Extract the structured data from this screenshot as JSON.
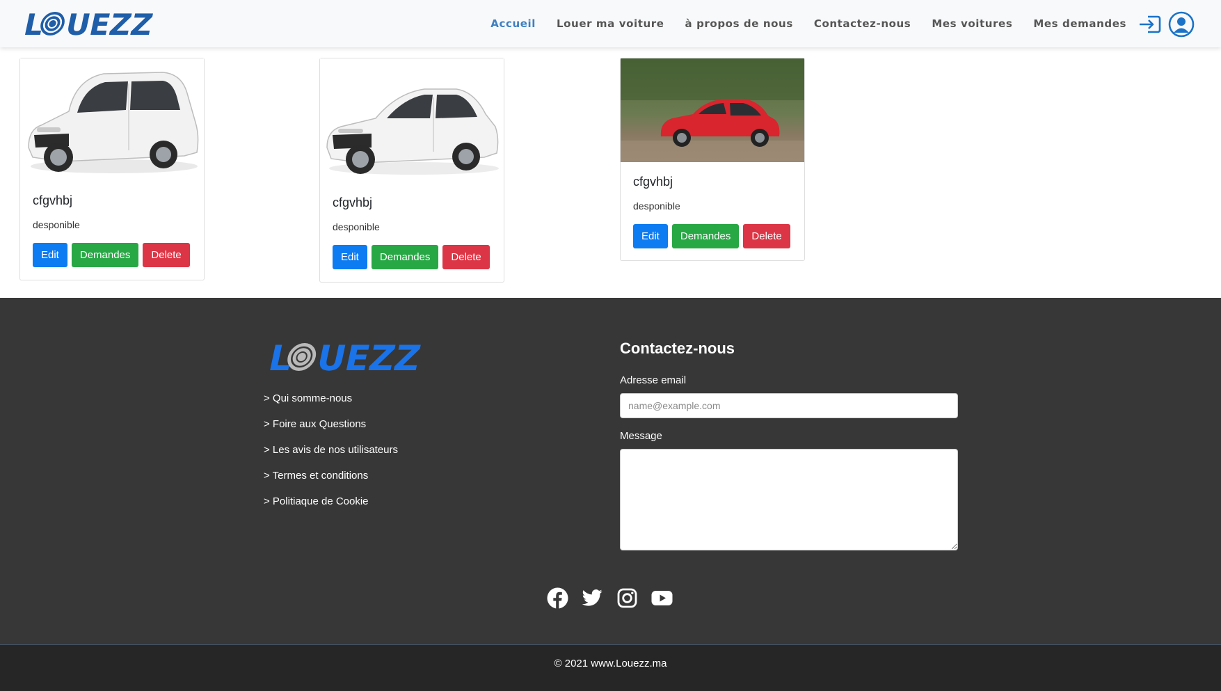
{
  "brand": {
    "logo_text": "LOUEZZ",
    "color": "#1f5ea8"
  },
  "nav": {
    "items": [
      {
        "label": "Accueil",
        "active": true
      },
      {
        "label": "Louer ma voiture",
        "active": false
      },
      {
        "label": "à propos de nous",
        "active": false
      },
      {
        "label": "Contactez-nous",
        "active": false
      },
      {
        "label": "Mes voitures",
        "active": false
      },
      {
        "label": "Mes demandes",
        "active": false
      }
    ],
    "icons": [
      "login-icon",
      "user-icon"
    ]
  },
  "cars": [
    {
      "title": "cfgvhbj",
      "status": "desponible",
      "image": "white-minivan",
      "buttons": {
        "edit": "Edit",
        "requests": "Demandes",
        "delete": "Delete"
      }
    },
    {
      "title": "cfgvhbj",
      "status": "desponible",
      "image": "white-sedan",
      "buttons": {
        "edit": "Edit",
        "requests": "Demandes",
        "delete": "Delete"
      }
    },
    {
      "title": "cfgvhbj",
      "status": "desponible",
      "image": "red-hatchback",
      "buttons": {
        "edit": "Edit",
        "requests": "Demandes",
        "delete": "Delete"
      }
    }
  ],
  "footer": {
    "logo_text": "LOUEZZ",
    "links": [
      "> Qui somme-nous",
      "> Foire aux Questions",
      "> Les avis de nos utilisateurs",
      "> Termes et conditions",
      "> Politiaque de Cookie"
    ],
    "contact": {
      "title": "Contactez-nous",
      "email_label": "Adresse email",
      "email_placeholder": "name@example.com",
      "message_label": "Message"
    },
    "socials": [
      "facebook-icon",
      "twitter-icon",
      "instagram-icon",
      "youtube-icon"
    ],
    "copyright": "© 2021 www.Louezz.ma"
  },
  "colors": {
    "primary": "#0d7bf2",
    "success": "#28a745",
    "danger": "#dc3545",
    "footer_bg": "#373737"
  }
}
